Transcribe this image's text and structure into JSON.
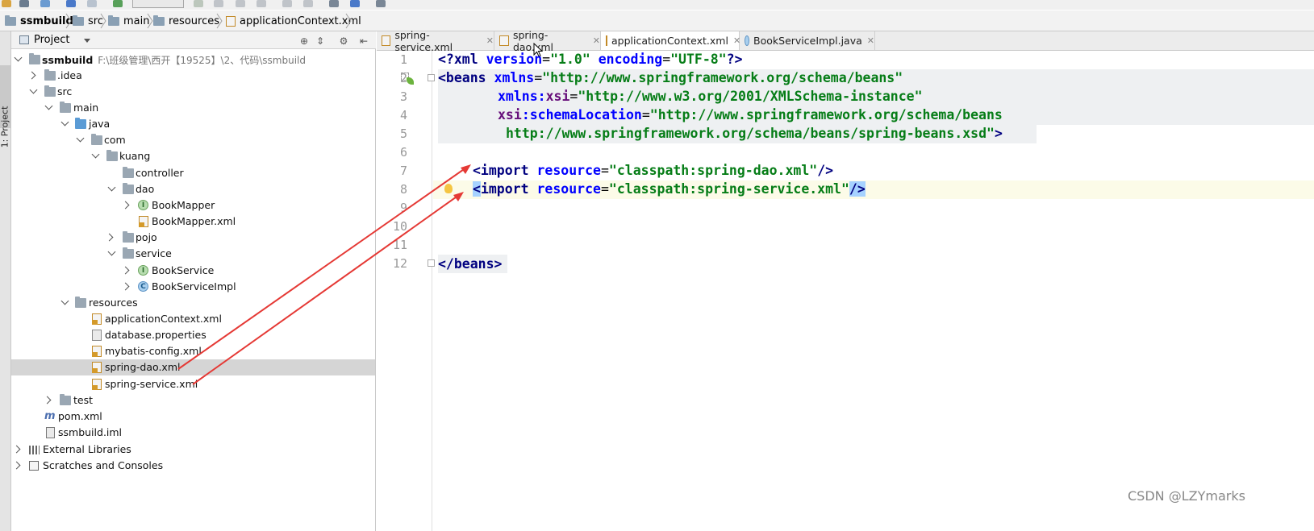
{
  "navbar": {
    "crumbs": [
      "ssmbuild",
      "src",
      "main",
      "resources",
      "applicationContext.xml"
    ]
  },
  "tool_window": {
    "stripe_label": "1: Project",
    "title": "Project"
  },
  "tree": {
    "root": {
      "label": "ssmbuild",
      "path": "F:\\班级管理\\西开【19525】\\2、代码\\ssmbuild"
    },
    "idea": ".idea",
    "src": "src",
    "main": "main",
    "java": "java",
    "com": "com",
    "kuang": "kuang",
    "controller": "controller",
    "dao": "dao",
    "book_mapper": "BookMapper",
    "book_mapper_xml": "BookMapper.xml",
    "pojo": "pojo",
    "service": "service",
    "book_service": "BookService",
    "book_service_impl": "BookServiceImpl",
    "resources": "resources",
    "application_context": "applicationContext.xml",
    "database_properties": "database.properties",
    "mybatis_config": "mybatis-config.xml",
    "spring_dao": "spring-dao.xml",
    "spring_service": "spring-service.xml",
    "test": "test",
    "pom": "pom.xml",
    "iml": "ssmbuild.iml",
    "external_libraries": "External Libraries",
    "scratches": "Scratches and Consoles"
  },
  "tabs": [
    {
      "label": "spring-service.xml",
      "active": false
    },
    {
      "label": "spring-dao.xml",
      "active": false
    },
    {
      "label": "applicationContext.xml",
      "active": true
    },
    {
      "label": "BookServiceImpl.java",
      "active": false
    }
  ],
  "editor": {
    "line_numbers": [
      "1",
      "2",
      "3",
      "4",
      "5",
      "6",
      "7",
      "8",
      "9",
      "10",
      "11",
      "12"
    ],
    "lines": {
      "l1": {
        "a": "<?",
        "b": "xml ",
        "c": "version",
        "d": "=",
        "e": "\"1.0\"",
        "f": " encoding",
        "g": "=",
        "h": "\"UTF-8\"",
        "i": "?>"
      },
      "l2": {
        "a": "<beans ",
        "b": "xmlns",
        "c": "=",
        "d": "\"http://www.springframework.org/schema/beans\""
      },
      "l3": {
        "a": "xmlns:",
        "b": "xsi",
        "c": "=",
        "d": "\"http://www.w3.org/2001/XMLSchema-instance\""
      },
      "l4": {
        "a": "xsi",
        "b": ":schemaLocation",
        "c": "=",
        "d": "\"http://www.springframework.org/schema/beans"
      },
      "l5": {
        "a": "http://www.springframework.org/schema/beans/spring-beans.xsd\"",
        "b": ">"
      },
      "l7": {
        "a": "<import ",
        "b": "resource",
        "c": "=",
        "d": "\"classpath:spring-dao.xml\"",
        "e": "/>"
      },
      "l8": {
        "a": "<",
        "b": "import ",
        "c": "resource",
        "d": "=",
        "e": "\"classpath:spring-service.xml\"",
        "f": "/>"
      },
      "l12": {
        "a": "</beans>"
      }
    },
    "colors": {
      "tag": "#000080",
      "attribute": "#0000ff",
      "namespace": "#660e7a",
      "string": "#067d17",
      "annotation_arrow": "#e53935"
    }
  },
  "watermark": "CSDN @LZYmarks"
}
